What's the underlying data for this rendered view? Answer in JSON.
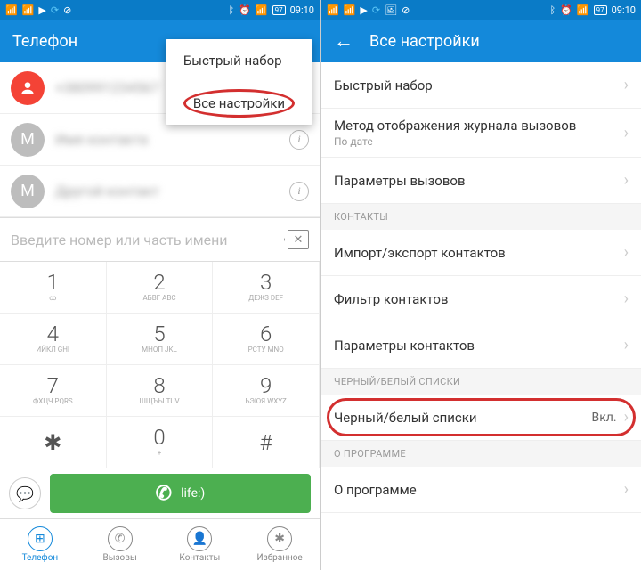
{
  "status": {
    "time": "09:10",
    "battery": "97"
  },
  "left": {
    "title": "Телефон",
    "popup": {
      "speed_dial": "Быстрый набор",
      "all_settings": "Все настройки"
    },
    "contacts": [
      {
        "avatar": "",
        "avatar_color": "red",
        "name": "+"
      },
      {
        "avatar": "M",
        "avatar_color": "gray",
        "name": " "
      },
      {
        "avatar": "M",
        "avatar_color": "gray",
        "name": " "
      }
    ],
    "dial_placeholder": "Введите номер или часть имени",
    "keys": [
      {
        "n": "1",
        "s": "∞"
      },
      {
        "n": "2",
        "s": "АБВГ\nABC"
      },
      {
        "n": "3",
        "s": "ДЕЖЗ\nDEF"
      },
      {
        "n": "4",
        "s": "ИЙКЛ\nGHI"
      },
      {
        "n": "5",
        "s": "МНОП\nJKL"
      },
      {
        "n": "6",
        "s": "РСТУ\nMNO"
      },
      {
        "n": "7",
        "s": "ФХЦЧ\nPQRS"
      },
      {
        "n": "8",
        "s": "ШЩЪЫ\nTUV"
      },
      {
        "n": "9",
        "s": "ЬЭЮЯ\nWXYZ"
      },
      {
        "n": "✱",
        "s": ""
      },
      {
        "n": "0",
        "s": "+"
      },
      {
        "n": "#",
        "s": ""
      }
    ],
    "call_label": "life:)",
    "nav": {
      "phone": "Телефон",
      "calls": "Вызовы",
      "contacts": "Контакты",
      "fav": "Избранное"
    }
  },
  "right": {
    "title": "Все настройки",
    "items": {
      "speed_dial": "Быстрый набор",
      "log_method": "Метод отображения журнала вызовов",
      "log_method_sub": "По дате",
      "call_params": "Параметры вызовов",
      "sec_contacts": "КОНТАКТЫ",
      "import": "Импорт/экспорт контактов",
      "filter": "Фильтр контактов",
      "contact_params": "Параметры контактов",
      "sec_lists": "ЧЕРНЫЙ/БЕЛЫЙ СПИСКИ",
      "bw_list": "Черный/белый списки",
      "bw_val": "Вкл.",
      "sec_about": "О ПРОГРАММЕ",
      "about": "О программе"
    }
  }
}
